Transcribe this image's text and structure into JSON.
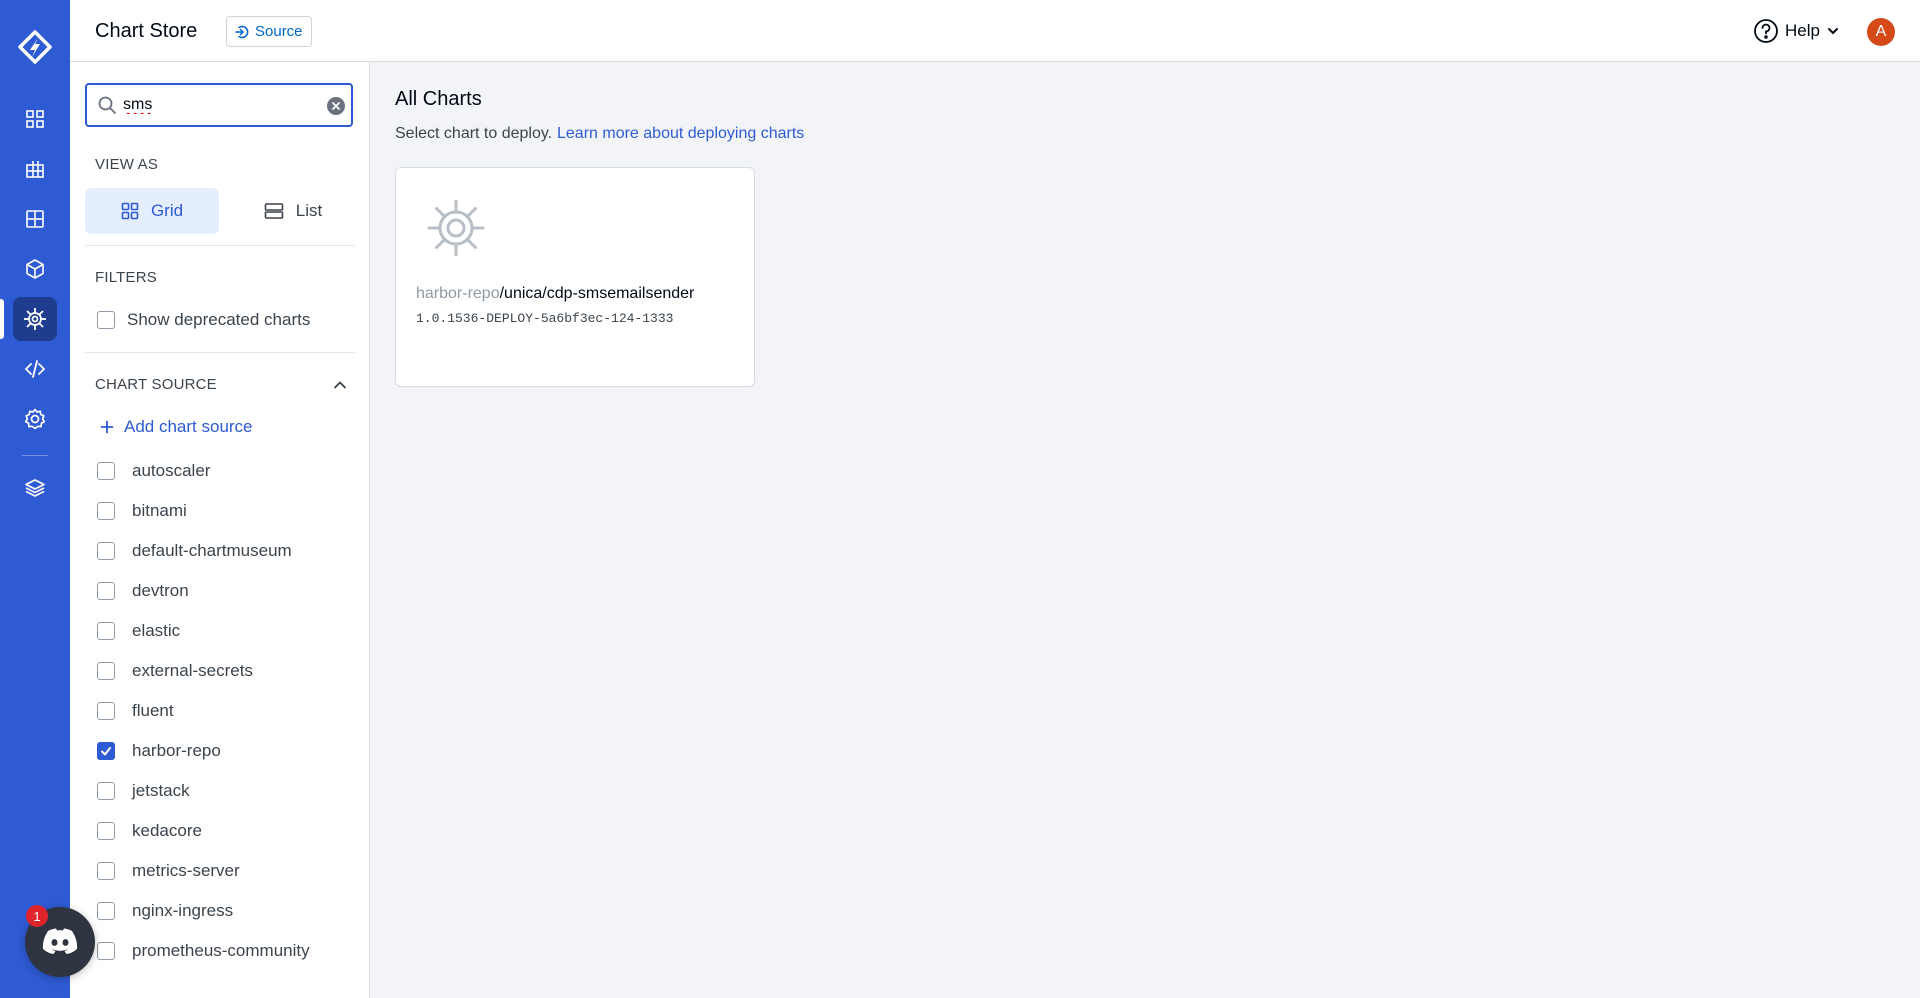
{
  "app": {
    "nav_icons": [
      "devtron-logo-icon",
      "app-list-icon",
      "job-list-icon",
      "resource-browser-icon",
      "cube-icon",
      "helm-wheel-icon",
      "code-icon",
      "settings-icon",
      "layers-icon"
    ],
    "colors": {
      "nav_bg": "#2e5ad3",
      "accent": "#2e5ad3",
      "avatar": "#d64a1a",
      "badge": "#e0242c"
    }
  },
  "header": {
    "title": "Chart Store",
    "source_button": "Source",
    "help_label": "Help",
    "avatar_initial": "A"
  },
  "sidebar": {
    "search": {
      "value": "sms",
      "placeholder": ""
    },
    "view_as_label": "VIEW AS",
    "view_grid": "Grid",
    "view_list": "List",
    "view_selected": "Grid",
    "filters_label": "FILTERS",
    "deprecated_label": "Show deprecated charts",
    "chart_source_label": "CHART SOURCE",
    "add_source_label": "Add chart source",
    "sources": [
      {
        "name": "autoscaler",
        "checked": false
      },
      {
        "name": "bitnami",
        "checked": false
      },
      {
        "name": "default-chartmuseum",
        "checked": false
      },
      {
        "name": "devtron",
        "checked": false
      },
      {
        "name": "elastic",
        "checked": false
      },
      {
        "name": "external-secrets",
        "checked": false
      },
      {
        "name": "fluent",
        "checked": false
      },
      {
        "name": "harbor-repo",
        "checked": true
      },
      {
        "name": "jetstack",
        "checked": false
      },
      {
        "name": "kedacore",
        "checked": false
      },
      {
        "name": "metrics-server",
        "checked": false
      },
      {
        "name": "nginx-ingress",
        "checked": false
      },
      {
        "name": "prometheus-community",
        "checked": false
      }
    ]
  },
  "main": {
    "title": "All Charts",
    "subtitle": "Select chart to deploy.",
    "learn_more": "Learn more about deploying charts",
    "cards": [
      {
        "repo": "harbor-repo",
        "chart": "/unica/cdp-smsemailsender",
        "version": "1.0.1536-DEPLOY-5a6bf3ec-124-1333"
      }
    ]
  },
  "discord": {
    "badge_count": "1"
  }
}
